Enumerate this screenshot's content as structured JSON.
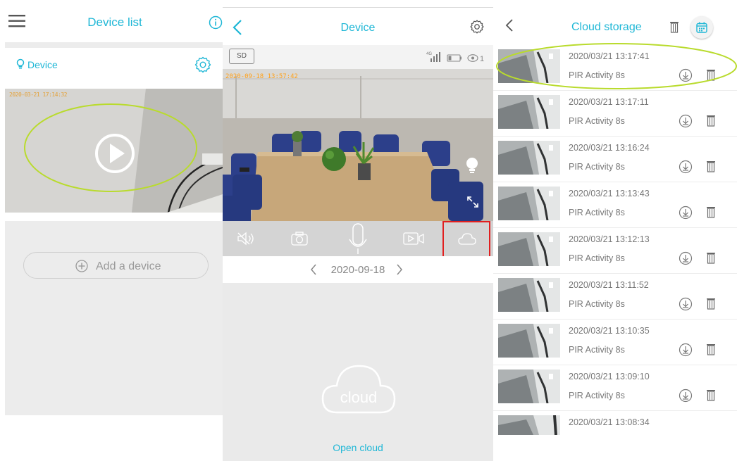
{
  "panel1": {
    "title": "Device list",
    "device_name": "Device",
    "thumbnail_timestamp": "2020-03-21 17:14:32",
    "add_device_label": "Add a device"
  },
  "panel2": {
    "title": "Device",
    "sd_badge": "SD",
    "network_label": "4G",
    "viewer_count": "1",
    "video_timestamp": "2020-09-18 13:57:42",
    "date": "2020-09-18",
    "cloud_graphic_label": "cloud",
    "open_cloud_label": "Open cloud"
  },
  "panel3": {
    "title": "Cloud storage",
    "records": [
      {
        "time": "2020/03/21 13:17:41",
        "desc": "PIR Activity 8s"
      },
      {
        "time": "2020/03/21 13:17:11",
        "desc": "PIR Activity 8s"
      },
      {
        "time": "2020/03/21 13:16:24",
        "desc": "PIR Activity 8s"
      },
      {
        "time": "2020/03/21 13:13:43",
        "desc": "PIR Activity 8s"
      },
      {
        "time": "2020/03/21 13:12:13",
        "desc": "PIR Activity 8s"
      },
      {
        "time": "2020/03/21 13:11:52",
        "desc": "PIR Activity 8s"
      },
      {
        "time": "2020/03/21 13:10:35",
        "desc": "PIR Activity 8s"
      },
      {
        "time": "2020/03/21 13:09:10",
        "desc": "PIR Activity 8s"
      },
      {
        "time": "2020/03/21 13:08:34",
        "desc": ""
      }
    ]
  },
  "colors": {
    "accent": "#1fb7d6",
    "highlight_ellipse": "#b9db2d",
    "highlight_box": "#e11f1f"
  },
  "icons": {
    "panel1": [
      "menu-icon",
      "info-icon",
      "bulb-icon",
      "gear-icon",
      "play-icon",
      "plus-circle-icon"
    ],
    "panel2": [
      "back-icon",
      "gear-icon",
      "signal-icon",
      "battery-icon",
      "eye-icon",
      "light-icon",
      "fullscreen-icon",
      "mute-icon",
      "camera-icon",
      "microphone-icon",
      "record-icon",
      "cloud-icon"
    ],
    "panel3": [
      "back-icon",
      "trash-icon",
      "calendar-icon",
      "download-icon"
    ]
  }
}
